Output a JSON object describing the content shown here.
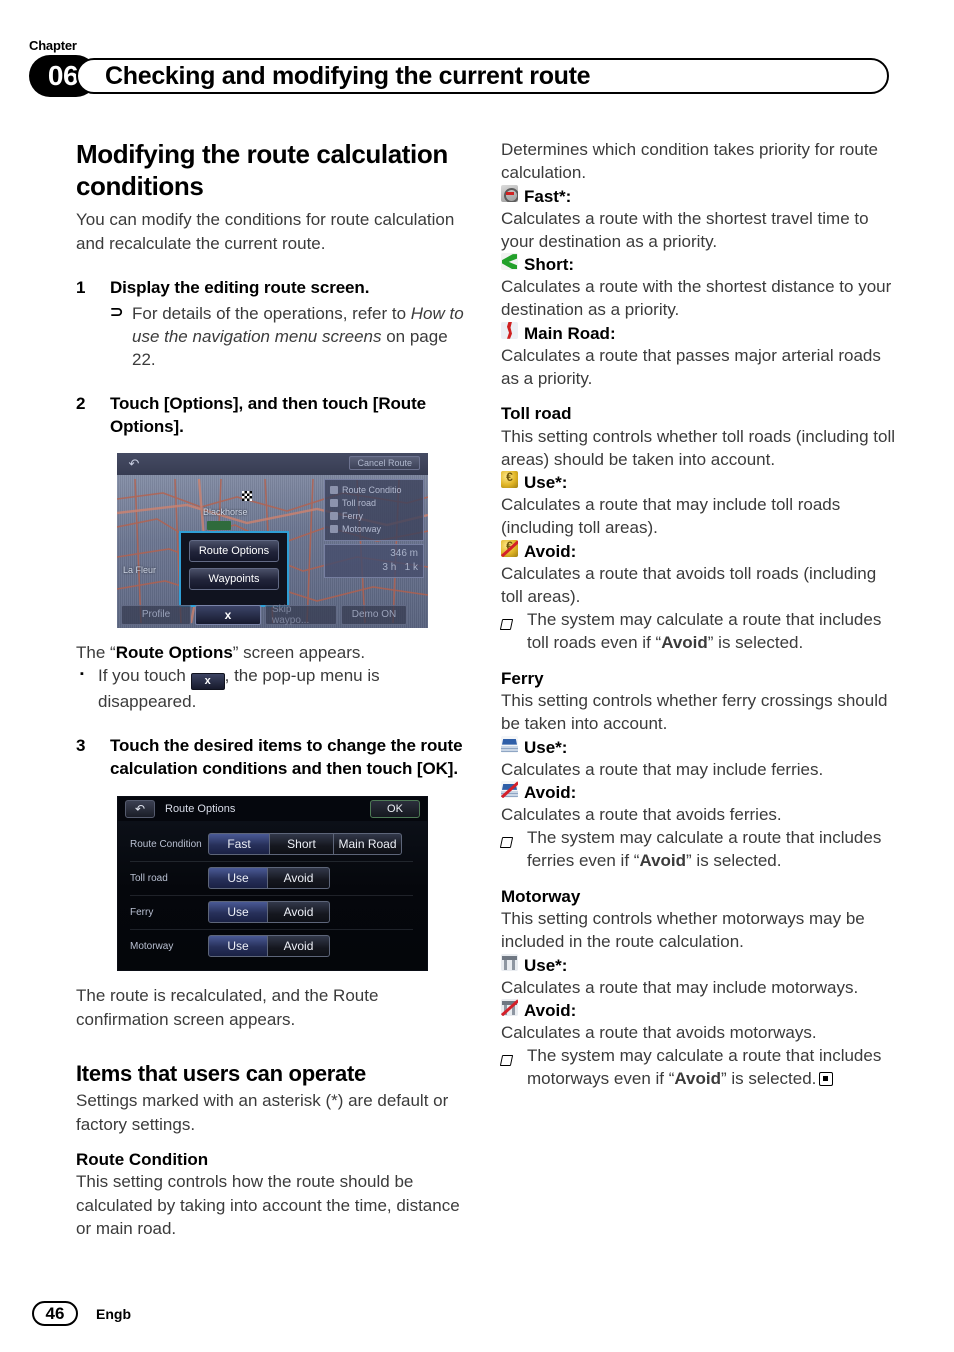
{
  "header": {
    "chapter_word": "Chapter",
    "chapter_number": "06",
    "title": "Checking and modifying the current route"
  },
  "left_column": {
    "section_title": "Modifying the route calculation conditions",
    "intro": "You can modify the conditions for route calculation and recalculate the current route.",
    "step1": {
      "number": "1",
      "text": "Display the editing route screen.",
      "note_glyph": "⊃",
      "note_a": "For details of the operations, refer to ",
      "note_italic": "How to use the navigation menu screens",
      "note_b": " on page 22."
    },
    "step2": {
      "number": "2",
      "text": "Touch [Options], and then touch [Route Options]."
    },
    "after_step2": {
      "line_a": "The “",
      "line_bold": "Route Options",
      "line_b": "” screen appears.",
      "bullet_glyph": "▪",
      "bullet_a": "If you touch ",
      "bullet_chip": "x",
      "bullet_b": ", the pop-up menu is disappeared."
    },
    "step3": {
      "number": "3",
      "text": "Touch the desired items to change the route calculation conditions and then touch [OK]."
    },
    "after_step3": "The route is recalculated, and the Route confirmation screen appears.",
    "section_title_2": "Items that users can operate",
    "intro_2": "Settings marked with an asterisk (*) are default or factory settings.",
    "route_condition_heading": "Route Condition",
    "route_condition_body": "This setting controls how the route should be calculated by taking into account the time, distance or main road."
  },
  "right_column": {
    "determines": "Determines which condition takes priority for route calculation.",
    "fast": {
      "icon": "fast-compass-icon",
      "label": "Fast*:",
      "body": "Calculates a route with the shortest travel time to your destination as a priority."
    },
    "short": {
      "icon": "short-green-arrow-icon",
      "label": "Short:",
      "body": "Calculates a route with the shortest distance to your destination as a priority."
    },
    "main_road": {
      "icon": "main-road-icon",
      "label": "Main Road:",
      "body": "Calculates a route that passes major arterial roads as a priority."
    },
    "toll": {
      "heading": "Toll road",
      "body": "This setting controls whether toll roads (including toll areas) should be taken into account.",
      "use_icon": "toll-coin-icon",
      "use_label": "Use*:",
      "use_body": "Calculates a route that may include toll roads (including toll areas).",
      "avoid_icon": "toll-coin-slashed-icon",
      "avoid_label": "Avoid:",
      "avoid_body": "Calculates a route that avoids toll roads (including toll areas).",
      "note_a": "The system may calculate a route that includes toll roads even if “",
      "note_bold": "Avoid",
      "note_b": "” is selected."
    },
    "ferry": {
      "heading": "Ferry",
      "body": "This setting controls whether ferry crossings should be taken into account.",
      "use_icon": "ferry-boat-icon",
      "use_label": "Use*:",
      "use_body": "Calculates a route that may include ferries.",
      "avoid_icon": "ferry-boat-slashed-icon",
      "avoid_label": "Avoid:",
      "avoid_body": "Calculates a route that avoids ferries.",
      "note_a": "The system may calculate a route that includes ferries even if “",
      "note_bold": "Avoid",
      "note_b": "” is selected."
    },
    "motorway": {
      "heading": "Motorway",
      "body": "This setting controls whether motorways may be included in the route calculation.",
      "use_icon": "motorway-overpass-icon",
      "use_label": "Use*:",
      "use_body": "Calculates a route that may include motorways.",
      "avoid_icon": "motorway-overpass-slashed-icon",
      "avoid_label": "Avoid:",
      "avoid_body": "Calculates a route that avoids motorways.",
      "note_a": "The system may calculate a route that includes motorways even if “",
      "note_bold": "Avoid",
      "note_b": "” is selected."
    }
  },
  "figure_map": {
    "back_icon": "back-arrow-icon",
    "cancel_route": "Cancel Route",
    "right_panel_items": [
      "Route Conditio",
      "Toll road",
      "Ferry",
      "Motorway"
    ],
    "eta_distance": "346 m",
    "eta_time_a": "3 h",
    "eta_time_b": "1 k",
    "map_label_1": "Blackhorse",
    "map_label_2": "La Fleur",
    "popup_buttons": [
      "Route Options",
      "Waypoints"
    ],
    "bottom_buttons": [
      "Profile",
      "x",
      "Skip waypo...",
      "Demo ON"
    ]
  },
  "figure_route_options": {
    "back_icon": "back-arrow-icon",
    "title": "Route Options",
    "ok_label": "OK",
    "rows": [
      {
        "label": "Route Condition",
        "options": [
          "Fast",
          "Short",
          "Main Road"
        ],
        "selected": 0
      },
      {
        "label": "Toll road",
        "options": [
          "Use",
          "Avoid"
        ],
        "selected": 0
      },
      {
        "label": "Ferry",
        "options": [
          "Use",
          "Avoid"
        ],
        "selected": 0
      },
      {
        "label": "Motorway",
        "options": [
          "Use",
          "Avoid"
        ],
        "selected": 0
      }
    ]
  },
  "footer": {
    "page_number": "46",
    "language": "Engb"
  }
}
